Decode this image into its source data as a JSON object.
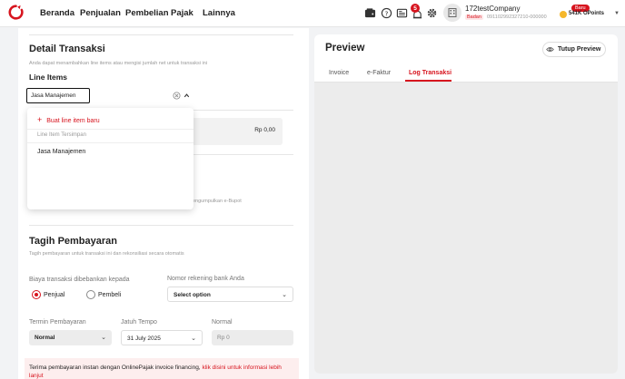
{
  "nav": {
    "items": [
      "Beranda",
      "Penjualan",
      "Pembelian",
      "Pajak",
      "Lainnya"
    ],
    "notification_count": "5",
    "company_name": "172testCompany",
    "company_type": "Badan",
    "npwp": "091102992327210-000000",
    "points_badge": "Baru",
    "points": "541K OPoints"
  },
  "detail": {
    "title": "Detail Transaksi",
    "subtitle": "Anda dapat menambahkan line items atau mengisi jumlah net untuk transaksi ini",
    "line_items_title": "Line Items",
    "line_item_input": "Jasa Manajemen",
    "amount": "Rp 0,00",
    "ebupot_note": "engumpulkan e-Bupot"
  },
  "dropdown": {
    "add_label": "Buat line item baru",
    "group_label": "Line Item Tersimpan",
    "items": [
      "Jasa Manajemen"
    ]
  },
  "tagih": {
    "title": "Tagih Pembayaran",
    "subtitle": "Tagih pembayaran untuk transaksi ini dan rekonsiliasi secara otomatis",
    "biaya_label": "Biaya transaksi dibebankan kepada",
    "option_penjual": "Penjual",
    "option_pembeli": "Pembeli",
    "rekening_label": "Nomor rekening bank Anda",
    "rekening_placeholder": "Select option",
    "termin_label": "Termin Pembayaran",
    "termin_value": "Normal",
    "jatuh_tempo_label": "Jatuh Tempo",
    "jatuh_tempo_value": "31 July 2025",
    "normal_label": "Normal",
    "normal_value": "Rp 0",
    "banner_text": "Terima pembayaran instan dengan OnlinePajak invoice financing,",
    "banner_link": "klik disini untuk informasi lebih lanjut"
  },
  "preview": {
    "title": "Preview",
    "close_label": "Tutup Preview",
    "tabs": [
      "Invoice",
      "e-Faktur",
      "Log Transaksi"
    ],
    "active_tab": "Log Transaksi"
  },
  "colors": {
    "accent": "#d7141e",
    "background": "#f2f3f5"
  }
}
